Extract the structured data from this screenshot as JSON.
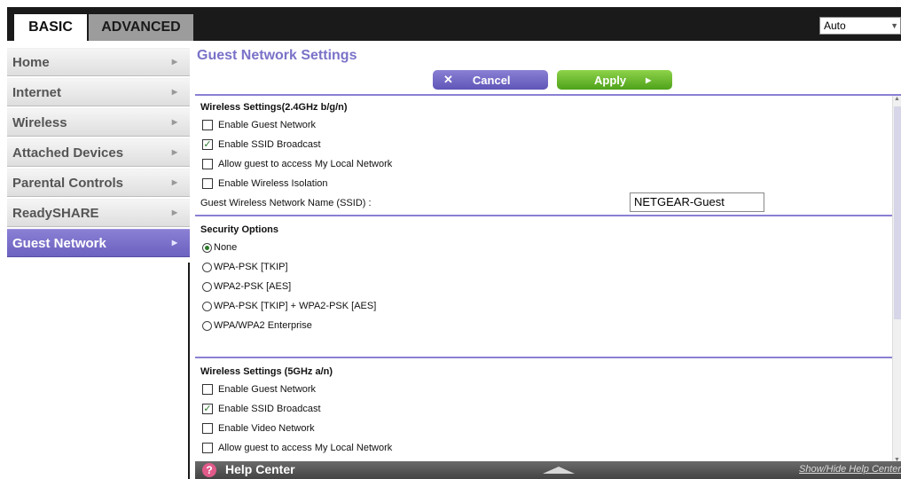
{
  "tabs": {
    "basic": "BASIC",
    "advanced": "ADVANCED"
  },
  "language": {
    "selected": "Auto"
  },
  "sidebar": {
    "items": [
      {
        "label": "Home"
      },
      {
        "label": "Internet"
      },
      {
        "label": "Wireless"
      },
      {
        "label": "Attached Devices"
      },
      {
        "label": "Parental Controls"
      },
      {
        "label": "ReadySHARE"
      },
      {
        "label": "Guest Network"
      }
    ],
    "active": "Guest Network"
  },
  "page": {
    "title": "Guest Network Settings",
    "cancel_label": "Cancel",
    "apply_label": "Apply"
  },
  "wireless_24": {
    "title": "Wireless Settings(2.4GHz b/g/n)",
    "options": [
      {
        "label": "Enable Guest Network",
        "checked": false
      },
      {
        "label": "Enable SSID Broadcast",
        "checked": true
      },
      {
        "label": "Allow guest to access My Local Network",
        "checked": false
      },
      {
        "label": "Enable Wireless Isolation",
        "checked": false
      }
    ],
    "ssid_label": "Guest Wireless Network Name (SSID) :",
    "ssid_value": "NETGEAR-Guest"
  },
  "security": {
    "title": "Security Options",
    "options": [
      {
        "label": "None",
        "selected": true
      },
      {
        "label": "WPA-PSK [TKIP]",
        "selected": false
      },
      {
        "label": "WPA2-PSK [AES]",
        "selected": false
      },
      {
        "label": "WPA-PSK [TKIP] + WPA2-PSK [AES]",
        "selected": false
      },
      {
        "label": "WPA/WPA2 Enterprise",
        "selected": false
      }
    ]
  },
  "wireless_5": {
    "title": "Wireless Settings (5GHz a/n)",
    "options": [
      {
        "label": "Enable Guest Network",
        "checked": false
      },
      {
        "label": "Enable SSID Broadcast",
        "checked": true
      },
      {
        "label": "Enable Video Network",
        "checked": false
      },
      {
        "label": "Allow guest to access My Local Network",
        "checked": false
      }
    ]
  },
  "help": {
    "title": "Help Center",
    "toggle_label": "Show/Hide Help Center"
  },
  "colors": {
    "accent": "#7a72c8",
    "apply": "#5fb127",
    "check": "#2a7a2a",
    "topbar": "#1a1a1a"
  }
}
